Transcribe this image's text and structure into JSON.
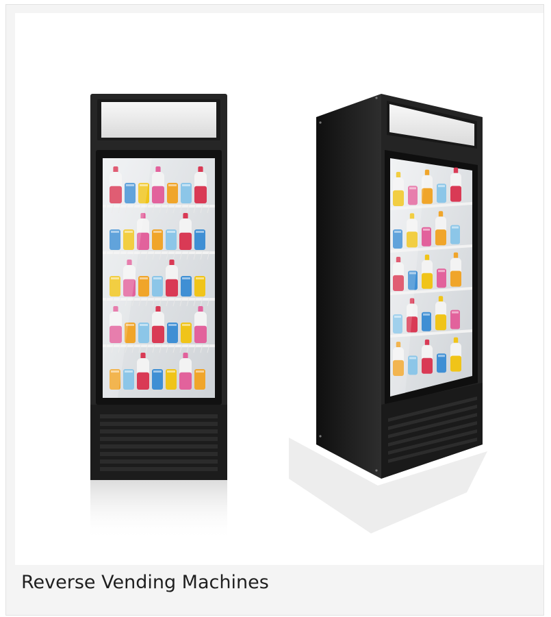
{
  "card": {
    "caption": "Reverse Vending Machines"
  },
  "image": {
    "subject": "two drink refrigerators stocked with bottles and cans",
    "colors": {
      "cabinet": "#262626",
      "cabinet_side": "#141414",
      "glass": "#dcdfe2",
      "shelf": "#f2f2f2",
      "red": "#d93a55",
      "blue": "#3f8fd4",
      "yellow": "#f0c419",
      "pink": "#e2629c",
      "orange": "#f0a52a",
      "light_blue": "#8cc6e8"
    }
  }
}
